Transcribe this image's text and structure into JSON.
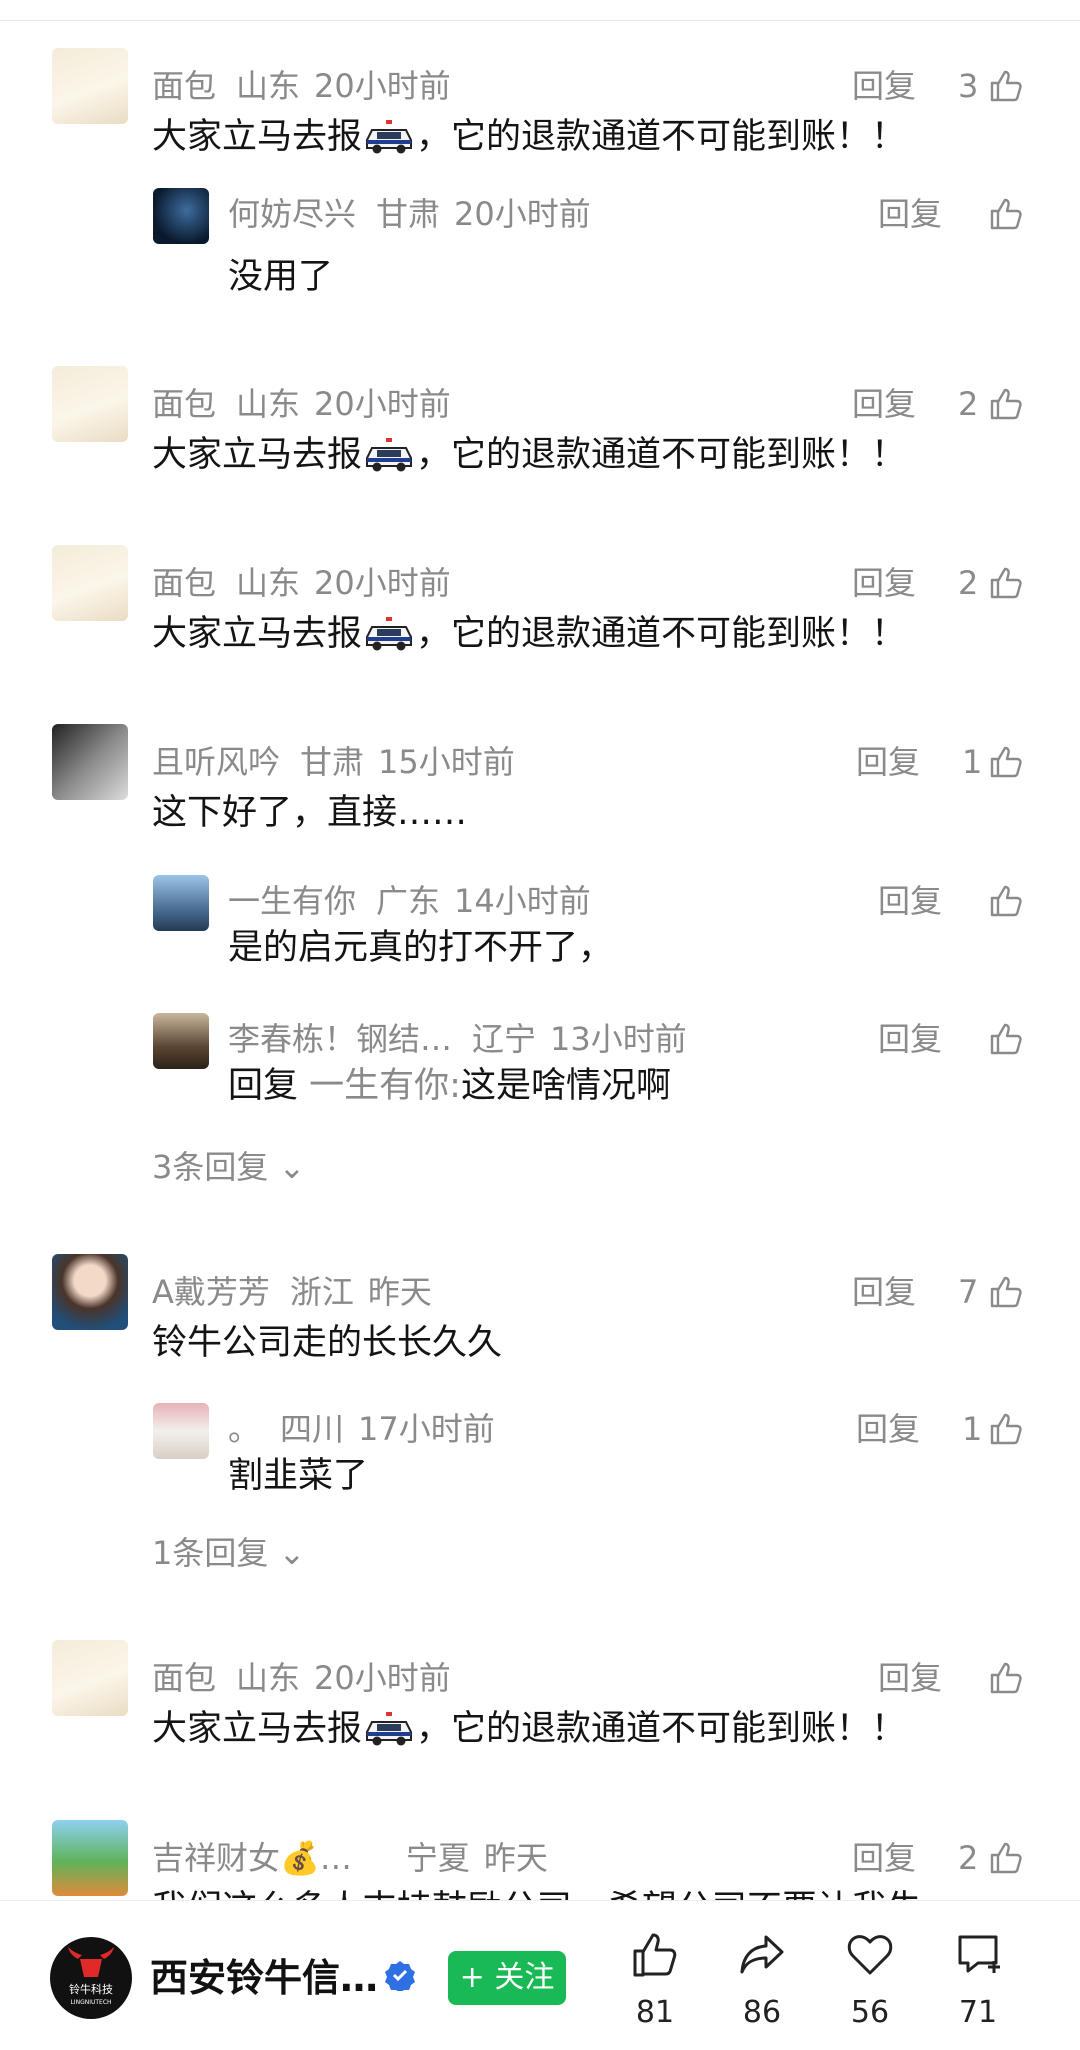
{
  "comments": [
    {
      "user": "面包",
      "loc": "山东",
      "time": "20小时前",
      "reply": "回复",
      "likes": "3",
      "text_pre": "大家立马去报",
      "text_post": "，它的退款通道不可能到账！！"
    },
    {
      "user": "何妨尽兴",
      "loc": "甘肃",
      "time": "20小时前",
      "reply": "回复",
      "likes": "",
      "text": "没用了"
    },
    {
      "user": "面包",
      "loc": "山东",
      "time": "20小时前",
      "reply": "回复",
      "likes": "2",
      "text_pre": "大家立马去报",
      "text_post": "，它的退款通道不可能到账！！"
    },
    {
      "user": "面包",
      "loc": "山东",
      "time": "20小时前",
      "reply": "回复",
      "likes": "2",
      "text_pre": "大家立马去报",
      "text_post": "，它的退款通道不可能到账！！"
    },
    {
      "user": "且听风吟",
      "loc": "甘肃",
      "time": "15小时前",
      "reply": "回复",
      "likes": "1",
      "text": "这下好了，直接……"
    },
    {
      "user": "一生有你",
      "loc": "广东",
      "time": "14小时前",
      "reply": "回复",
      "likes": "",
      "text": "是的启元真的打不开了，"
    },
    {
      "user": "李春栋！钢结…",
      "loc": "辽宁",
      "time": "13小时前",
      "reply": "回复",
      "likes": "",
      "reply_prefix": "回复",
      "reply_to": "一生有你:",
      "text": "这是啥情况啊"
    },
    {
      "user": "A戴芳芳",
      "loc": "浙江",
      "time": "昨天",
      "reply": "回复",
      "likes": "7",
      "text": "铃牛公司走的长长久久"
    },
    {
      "user": "。",
      "loc": "四川",
      "time": "17小时前",
      "reply": "回复",
      "likes": "1",
      "text": "割韭菜了"
    },
    {
      "user": "面包",
      "loc": "山东",
      "time": "20小时前",
      "reply": "回复",
      "likes": "",
      "text_pre": "大家立马去报",
      "text_post": "，它的退款通道不可能到账！！"
    },
    {
      "user": "吉祥财女💰…",
      "loc": "宁夏",
      "time": "昨天",
      "reply": "回复",
      "likes": "2",
      "text": "我们这么多人支持鼓励公司，希望公司不要让我失"
    }
  ],
  "expanders": {
    "first": "3条回复",
    "second": "1条回复"
  },
  "bottom": {
    "account_name": "西安铃牛信…",
    "logo_text_cn": "铃牛科技",
    "logo_text_en": "LINGNIUTECH",
    "follow_label": "+ 关注",
    "like_count": "81",
    "share_count": "86",
    "fav_count": "56",
    "comment_count": "71"
  },
  "colors": {
    "follow": "#19b955",
    "meta": "#8a8a8a",
    "verified": "#2f6fe4"
  }
}
